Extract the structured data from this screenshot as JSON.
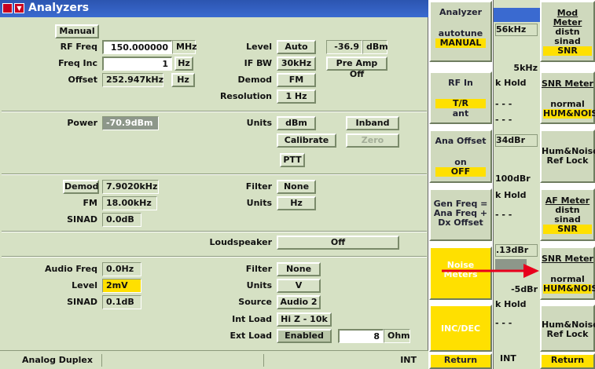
{
  "window": {
    "title": "Analyzers"
  },
  "section1": {
    "manual_label": "Manual",
    "rf_freq": {
      "label": "RF Freq",
      "value": "150.000000",
      "unit": "MHz"
    },
    "freq_inc": {
      "label": "Freq Inc",
      "value": "1",
      "unit": "Hz"
    },
    "offset": {
      "label": "Offset",
      "value": "252.947kHz",
      "unit": "Hz"
    },
    "level": {
      "label": "Level",
      "mode": "Auto",
      "value": "-36.9",
      "unit": "dBm"
    },
    "if_bw": {
      "label": "IF BW",
      "value": "30kHz",
      "preamp": "Pre Amp Off"
    },
    "demod": {
      "label": "Demod",
      "value": "FM"
    },
    "resolution": {
      "label": "Resolution",
      "value": "1 Hz"
    }
  },
  "section2": {
    "power": {
      "label": "Power",
      "value": "-70.9dBm"
    },
    "units": {
      "label": "Units",
      "value": "dBm"
    },
    "inband": "Inband",
    "calibrate": "Calibrate",
    "zero": "Zero",
    "ptt": "PTT"
  },
  "section3": {
    "demod": {
      "label": "Demod",
      "value": "7.9020kHz"
    },
    "fm": {
      "label": "FM",
      "value": "18.00kHz"
    },
    "sinad": {
      "label": "SINAD",
      "value": "0.0dB"
    },
    "filter": {
      "label": "Filter",
      "value": "None"
    },
    "units": {
      "label": "Units",
      "value": "Hz"
    }
  },
  "section4": {
    "loudspeaker": {
      "label": "Loudspeaker",
      "value": "Off"
    }
  },
  "section5": {
    "audio_freq": {
      "label": "Audio Freq",
      "value": "0.0Hz"
    },
    "level": {
      "label": "Level",
      "value": "2mV"
    },
    "sinad": {
      "label": "SINAD",
      "value": "0.1dB"
    },
    "filter": {
      "label": "Filter",
      "value": "None"
    },
    "units": {
      "label": "Units",
      "value": "V"
    },
    "source": {
      "label": "Source",
      "value": "Audio 2"
    },
    "int_load": {
      "label": "Int Load",
      "value": "Hi Z - 10k"
    },
    "ext_load": {
      "label": "Ext Load",
      "state": "Enabled",
      "value": "8",
      "unit": "Ohm"
    }
  },
  "status": {
    "mode": "Analog Duplex",
    "int": "INT"
  },
  "softkeys": {
    "analyzer": {
      "title": "Analyzer",
      "opt1": "autotune",
      "opt2": "MANUAL"
    },
    "rf_in": {
      "title": "RF In",
      "opt1": "T/R",
      "opt2": "ant"
    },
    "ana_offset": {
      "title": "Ana Offset",
      "opt1": "on",
      "opt2": "OFF"
    },
    "gen_freq": {
      "line1": "Gen Freq =",
      "line2": "Ana Freq +",
      "line3": "Dx Offset"
    },
    "noise_meters": {
      "line1": "Noise",
      "line2": "Meters"
    },
    "inc_dec": "INC/DEC",
    "return": "Return"
  },
  "background_window": {
    "v1": "56kHz",
    "v2": "5kHz",
    "v3": "k Hold",
    "v4": "- - -",
    "v5": "- - -",
    "v6": "34dBr",
    "v7": "100dBr",
    "v8": "k Hold",
    "v9": "- - -",
    "v10": ".13dBr",
    "v11": "-5dBr",
    "v12": "k Hold",
    "v13": "- - -",
    "int": "INT"
  },
  "right_keys": {
    "mod_meter": {
      "title": "Mod Meter",
      "l1": "distn",
      "l2": "sinad",
      "l3": "SNR"
    },
    "snr_meter1": {
      "title": "SNR Meter",
      "l1": "normal",
      "l2": "HUM&NOIS"
    },
    "hum_lock1": {
      "l1": "Hum&Noise",
      "l2": "Ref Lock"
    },
    "af_meter": {
      "title": "AF Meter",
      "l1": "distn",
      "l2": "sinad",
      "l3": "SNR"
    },
    "snr_meter2": {
      "title": "SNR Meter",
      "l1": "normal",
      "l2": "HUM&NOIS"
    },
    "hum_lock2": {
      "l1": "Hum&Noise",
      "l2": "Ref Lock"
    },
    "return": "Return"
  },
  "colors": {
    "accent_yellow": "#ffe000",
    "title_blue": "#3a6ad0",
    "panel_green": "#d6e1c4",
    "arrow_red": "#e8001c"
  }
}
